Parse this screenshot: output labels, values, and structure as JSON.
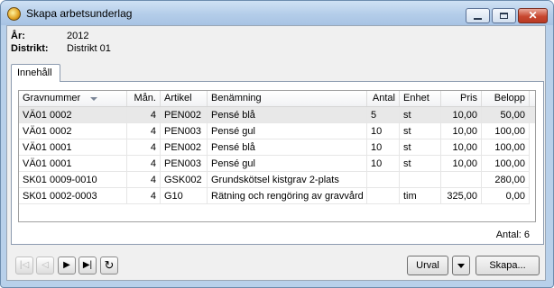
{
  "window": {
    "title": "Skapa arbetsunderlag"
  },
  "info": [
    {
      "label": "År:",
      "value": "2012"
    },
    {
      "label": "Distrikt:",
      "value": "Distrikt 01"
    }
  ],
  "tabs": [
    {
      "label": "Innehåll"
    }
  ],
  "table": {
    "columns": [
      "Gravnummer",
      "Mån.",
      "Artikel",
      "Benämning",
      "Antal",
      "Enhet",
      "Pris",
      "Belopp"
    ],
    "rows": [
      [
        "VÄ01 0002",
        "4",
        "PEN002",
        "Pensé blå",
        "5",
        "st",
        "10,00",
        "50,00"
      ],
      [
        "VÄ01 0002",
        "4",
        "PEN003",
        "Pensé gul",
        "10",
        "st",
        "10,00",
        "100,00"
      ],
      [
        "VÄ01 0001",
        "4",
        "PEN002",
        "Pensé blå",
        "10",
        "st",
        "10,00",
        "100,00"
      ],
      [
        "VÄ01 0001",
        "4",
        "PEN003",
        "Pensé gul",
        "10",
        "st",
        "10,00",
        "100,00"
      ],
      [
        "SK01 0009-0010",
        "4",
        "GSK002",
        "Grundskötsel kistgrav 2-plats",
        "",
        "",
        "",
        "280,00"
      ],
      [
        "SK01 0002-0003",
        "4",
        "G10",
        "Rätning och rengöring av gravvård",
        "",
        "tim",
        "325,00",
        "0,00"
      ]
    ],
    "count_label": "Antal: 6"
  },
  "nav": {
    "first": "|◁",
    "prev": "◁",
    "next": "▶",
    "last": "▶|",
    "refresh": "↻"
  },
  "buttons": {
    "urval": "Urval",
    "skapa": "Skapa..."
  },
  "icons": {
    "app": "app-logo-icon",
    "sort": "sort-descending-icon",
    "dropdown": "chevron-down-icon"
  }
}
